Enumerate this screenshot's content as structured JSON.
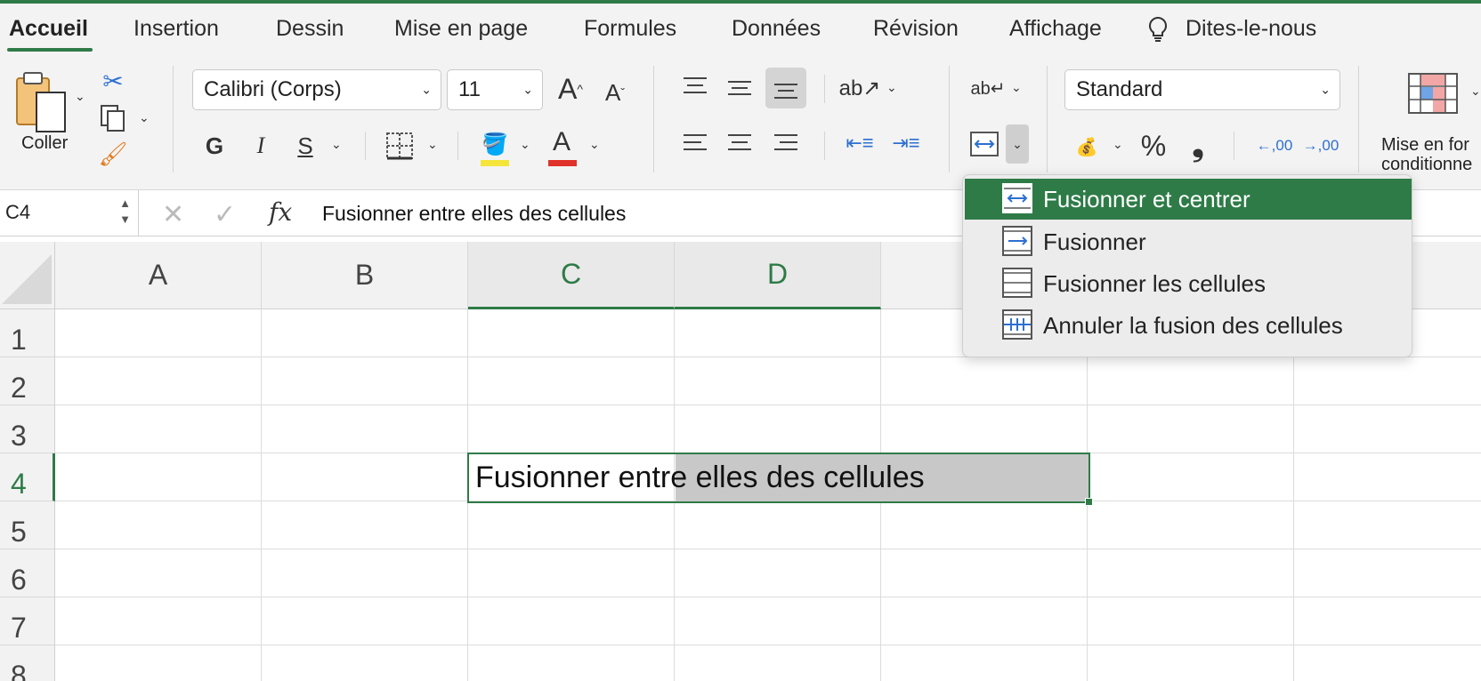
{
  "tabs": [
    "Accueil",
    "Insertion",
    "Dessin",
    "Mise en page",
    "Formules",
    "Données",
    "Révision",
    "Affichage",
    "Dites-le-nous"
  ],
  "ribbon": {
    "paste_label": "Coller",
    "font_name": "Calibri (Corps)",
    "font_size": "11",
    "bold": "G",
    "italic": "I",
    "underline": "S",
    "font_color_letter": "A",
    "grow_font": "A",
    "shrink_font": "A",
    "number_format": "Standard",
    "percent": "%",
    "comma": "❟",
    "cond_format_label_1": "Mise en for",
    "cond_format_label_2": "conditionne",
    "inc_decimal": ",00",
    "dec_decimal": ",00"
  },
  "formula_bar": {
    "name_box": "C4",
    "fx": "fx",
    "content": "Fusionner entre elles des cellules"
  },
  "grid": {
    "columns": [
      "A",
      "B",
      "C",
      "D"
    ],
    "rows": [
      "1",
      "2",
      "3",
      "4",
      "5",
      "6",
      "7",
      "8"
    ],
    "active_cell_text": "Fusionner entre elles des cellules"
  },
  "merge_menu": {
    "items": [
      "Fusionner et centrer",
      "Fusionner",
      "Fusionner les cellules",
      "Annuler la fusion des cellules"
    ]
  },
  "colors": {
    "accent": "#2e7b47",
    "highlight_yellow": "#f5e53a",
    "font_red": "#e0312b"
  }
}
